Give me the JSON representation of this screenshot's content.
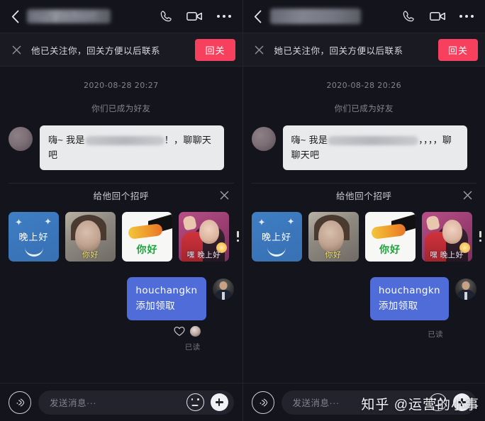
{
  "panels": [
    {
      "header": {
        "back_icon": "chevron-left-icon",
        "title_redacted": "~..,·'|/·~·!~~!",
        "call_icon": "phone-icon",
        "video_icon": "video-camera-icon",
        "more_icon": "more-horizontal-icon"
      },
      "banner": {
        "close_icon": "close-icon",
        "text": "他已关注你，回关方便以后联系",
        "button_label": "回关",
        "button_color": "#f6405e"
      },
      "chat": {
        "timestamp": "2020-08-28 20:27",
        "system_note": "你们已成为好友",
        "incoming": {
          "avatar": "contact-avatar",
          "prefix": "嗨~ 我是",
          "suffix": "！，聊聊天吧"
        },
        "outgoing": {
          "line1": "houchangkn",
          "line2": "添加领取",
          "avatar": "self-avatar",
          "reaction_icon": "heart-outline-icon",
          "reaction_avatar": "reactor-avatar",
          "read_status": "已读",
          "has_reaction": true
        }
      },
      "greeting": {
        "title": "给他回个招呼",
        "close_icon": "close-icon",
        "stickers": [
          {
            "id": "sticker-night",
            "label": "晚上好",
            "kind": "night"
          },
          {
            "id": "sticker-portrait-hello",
            "label": "你好",
            "kind": "portrait"
          },
          {
            "id": "sticker-orange-hello",
            "label": "你好",
            "kind": "orange"
          },
          {
            "id": "sticker-wave-hello",
            "label": "嘿 晚上好",
            "kind": "wave"
          }
        ]
      },
      "footer": {
        "voice_icon": "voice-wave-icon",
        "placeholder": "发送消息···",
        "emoji_icon": "emoji-smiley-icon",
        "plus_icon": "plus-icon"
      }
    },
    {
      "header": {
        "back_icon": "chevron-left-icon",
        "title_redacted": "",
        "call_icon": "phone-icon",
        "video_icon": "video-camera-icon",
        "more_icon": "more-horizontal-icon"
      },
      "banner": {
        "close_icon": "close-icon",
        "text": "她已关注你，回关方便以后联系",
        "button_label": "回关",
        "button_color": "#f6405e"
      },
      "chat": {
        "timestamp": "2020-08-28 20:26",
        "system_note": "你们已成为好友",
        "incoming": {
          "avatar": "contact-avatar",
          "prefix": "嗨~ 我是",
          "suffix": "，，，，聊聊天吧"
        },
        "outgoing": {
          "line1": "houchangkn",
          "line2": "添加领取",
          "avatar": "self-avatar",
          "reaction_icon": "heart-outline-icon",
          "reaction_avatar": "reactor-avatar",
          "read_status": "已读",
          "has_reaction": false
        }
      },
      "greeting": {
        "title": "给他回个招呼",
        "close_icon": "close-icon",
        "stickers": [
          {
            "id": "sticker-night",
            "label": "晚上好",
            "kind": "night"
          },
          {
            "id": "sticker-portrait-hello",
            "label": "你好",
            "kind": "portrait"
          },
          {
            "id": "sticker-orange-hello",
            "label": "你好",
            "kind": "orange"
          },
          {
            "id": "sticker-wave-hello",
            "label": "嘿 晚上好",
            "kind": "wave"
          }
        ]
      },
      "footer": {
        "voice_icon": "voice-wave-icon",
        "placeholder": "发送消息···",
        "emoji_icon": "emoji-smiley-icon",
        "plus_icon": "plus-icon"
      }
    }
  ],
  "watermark": "知乎 @运营的小事",
  "theme": {
    "background": "#14151c",
    "banner_bg": "#191a22",
    "accent_red": "#f6405e",
    "bubble_out": "#4f6cd8",
    "bubble_in": "#e9eaec"
  }
}
